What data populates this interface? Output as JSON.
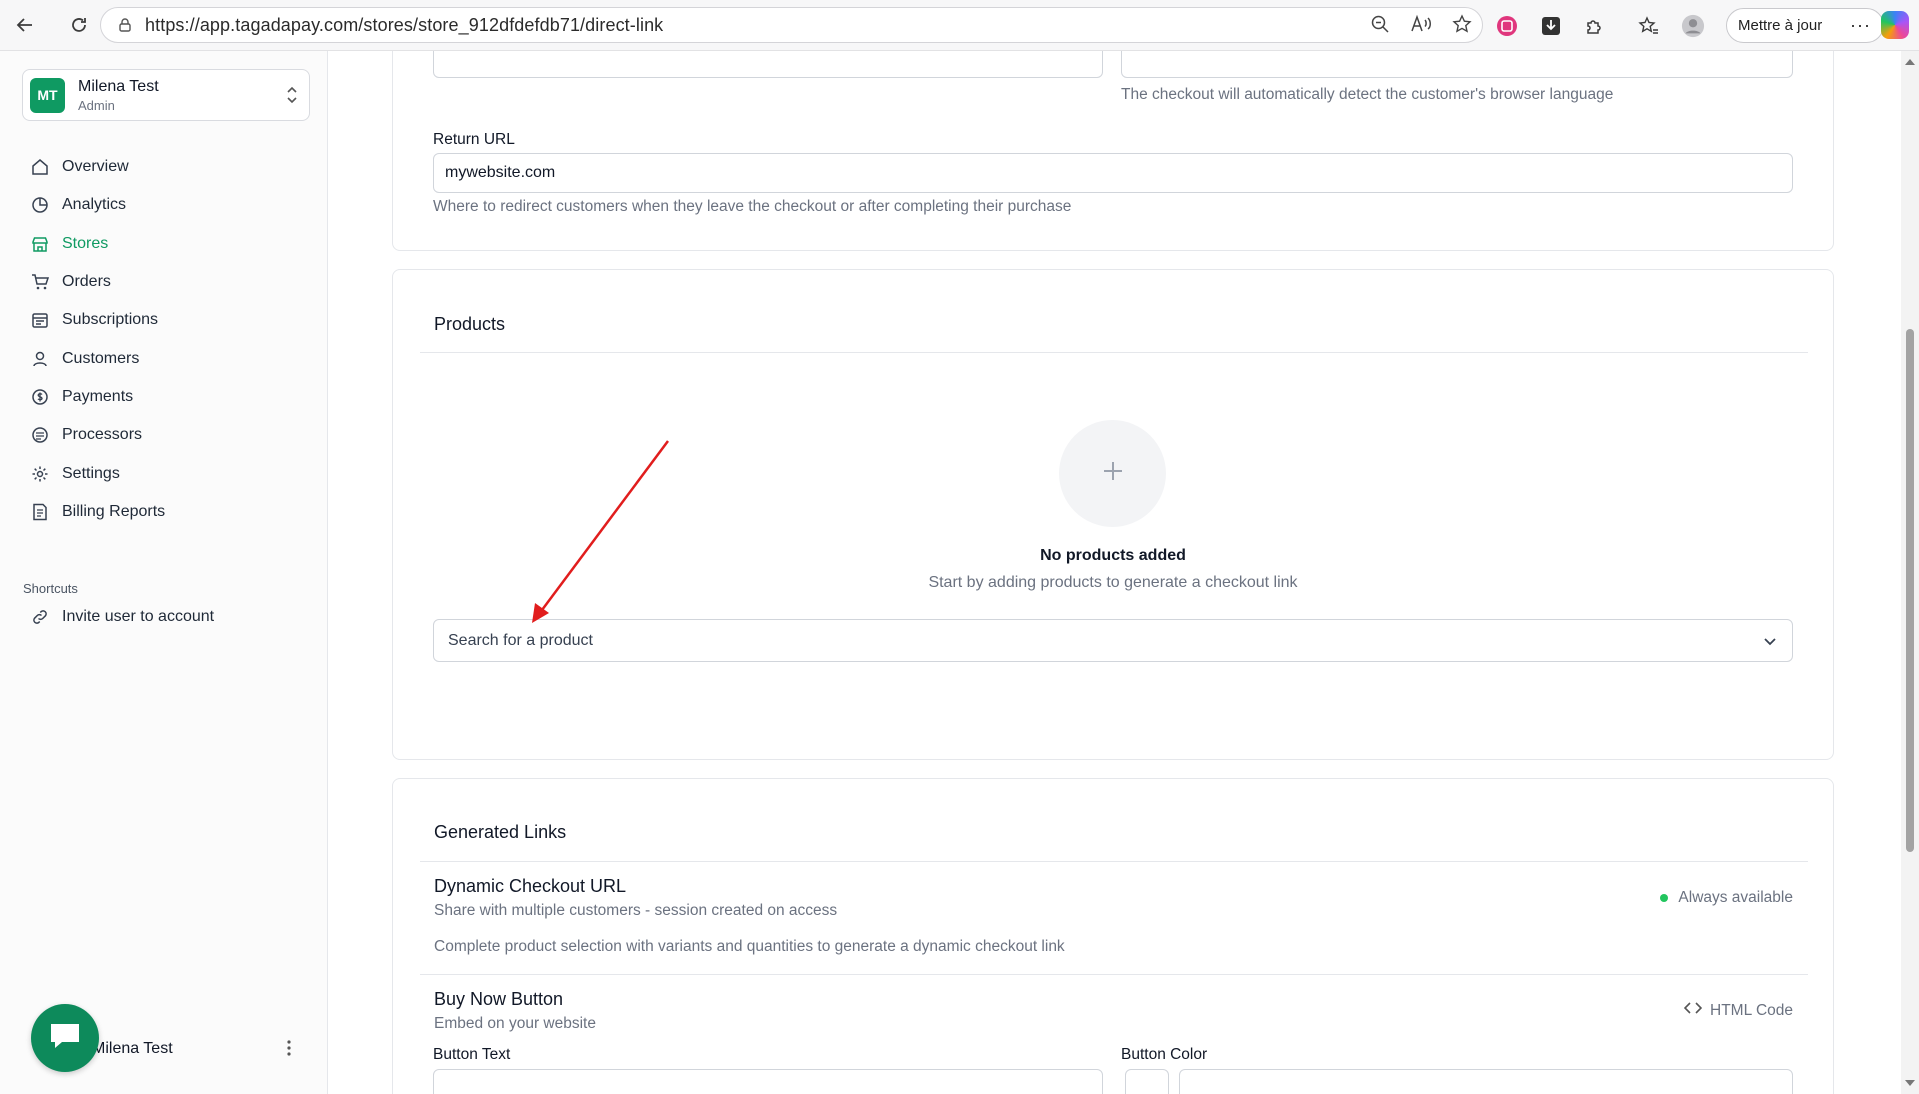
{
  "browser": {
    "url": "https://app.tagadapay.com/stores/store_912dfdefdb71/direct-link",
    "update_label": "Mettre à jour"
  },
  "sidebar": {
    "account": {
      "initials": "MT",
      "name": "Milena Test",
      "role": "Admin"
    },
    "nav": [
      {
        "label": "Overview",
        "icon": "home-icon"
      },
      {
        "label": "Analytics",
        "icon": "pie-chart-icon"
      },
      {
        "label": "Stores",
        "icon": "store-icon",
        "active": true
      },
      {
        "label": "Orders",
        "icon": "cart-icon"
      },
      {
        "label": "Subscriptions",
        "icon": "calendar-icon"
      },
      {
        "label": "Customers",
        "icon": "user-icon"
      },
      {
        "label": "Payments",
        "icon": "dollar-icon"
      },
      {
        "label": "Processors",
        "icon": "processor-icon"
      },
      {
        "label": "Settings",
        "icon": "gear-icon"
      },
      {
        "label": "Billing Reports",
        "icon": "report-icon"
      }
    ],
    "shortcuts_title": "Shortcuts",
    "shortcut_invite": "Invite user to account",
    "footer_user": "Milena Test"
  },
  "checkout_settings": {
    "language_helper": "The checkout will automatically detect the customer's browser language",
    "return_url_label": "Return URL",
    "return_url_value": "mywebsite.com",
    "return_url_helper": "Where to redirect customers when they leave the checkout or after completing their purchase"
  },
  "products": {
    "title": "Products",
    "empty_title": "No products added",
    "empty_sub": "Start by adding products to generate a checkout link",
    "search_placeholder": "Search for a product"
  },
  "generated_links": {
    "title": "Generated Links",
    "dynamic_title": "Dynamic Checkout URL",
    "dynamic_sub": "Share with multiple customers - session created on access",
    "dynamic_status": "Always available",
    "dynamic_note": "Complete product selection with variants and quantities to generate a dynamic checkout link",
    "buy_title": "Buy Now Button",
    "buy_sub": "Embed on your website",
    "html_code": "HTML Code",
    "button_text_label": "Button Text",
    "button_color_label": "Button Color"
  },
  "colors": {
    "brand_green": "#0f9a62",
    "status_green": "#22c55e",
    "annotation_red": "#e11d1d"
  }
}
